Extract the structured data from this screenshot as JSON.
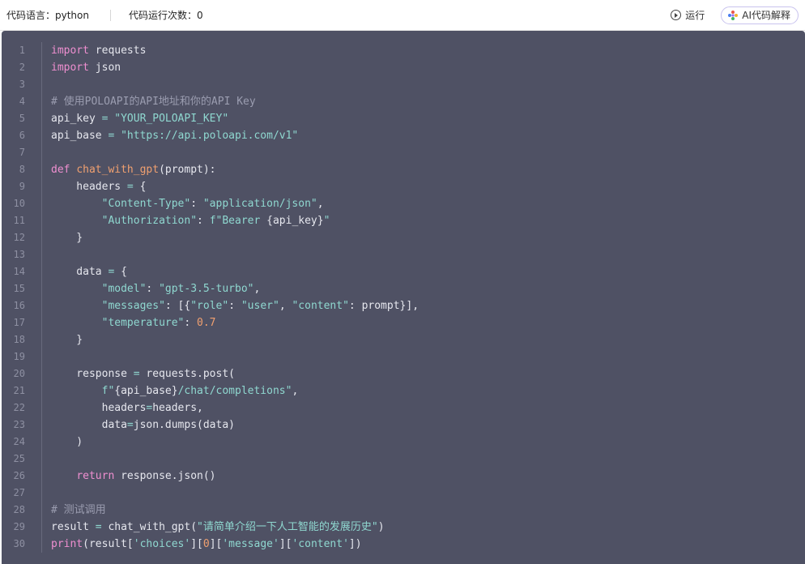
{
  "toolbar": {
    "language_label": "代码语言：python",
    "run_count_label": "代码运行次数：0",
    "run_label": "运行",
    "ai_label": "AI代码解释"
  },
  "code_lines": [
    {
      "n": "1",
      "t": [
        {
          "c": "k",
          "v": "import"
        },
        {
          "c": "p",
          "v": " requests"
        }
      ]
    },
    {
      "n": "2",
      "t": [
        {
          "c": "k",
          "v": "import"
        },
        {
          "c": "p",
          "v": " json"
        }
      ]
    },
    {
      "n": "3",
      "t": []
    },
    {
      "n": "4",
      "t": [
        {
          "c": "c",
          "v": "# 使用POLOAPI的API地址和你的API Key"
        }
      ]
    },
    {
      "n": "5",
      "t": [
        {
          "c": "p",
          "v": "api_key "
        },
        {
          "c": "o",
          "v": "="
        },
        {
          "c": "p",
          "v": " "
        },
        {
          "c": "s",
          "v": "\"YOUR_POLOAPI_KEY\""
        }
      ]
    },
    {
      "n": "6",
      "t": [
        {
          "c": "p",
          "v": "api_base "
        },
        {
          "c": "o",
          "v": "="
        },
        {
          "c": "p",
          "v": " "
        },
        {
          "c": "s",
          "v": "\"https://api.poloapi.com/v1\""
        }
      ]
    },
    {
      "n": "7",
      "t": []
    },
    {
      "n": "8",
      "t": [
        {
          "c": "k",
          "v": "def"
        },
        {
          "c": "p",
          "v": " "
        },
        {
          "c": "f",
          "v": "chat_with_gpt"
        },
        {
          "c": "p",
          "v": "(prompt):"
        }
      ]
    },
    {
      "n": "9",
      "t": [
        {
          "c": "p",
          "v": "    headers "
        },
        {
          "c": "o",
          "v": "="
        },
        {
          "c": "p",
          "v": " {"
        }
      ]
    },
    {
      "n": "10",
      "t": [
        {
          "c": "p",
          "v": "        "
        },
        {
          "c": "s",
          "v": "\"Content-Type\""
        },
        {
          "c": "p",
          "v": ": "
        },
        {
          "c": "s",
          "v": "\"application/json\""
        },
        {
          "c": "p",
          "v": ","
        }
      ]
    },
    {
      "n": "11",
      "t": [
        {
          "c": "p",
          "v": "        "
        },
        {
          "c": "s",
          "v": "\"Authorization\""
        },
        {
          "c": "p",
          "v": ": "
        },
        {
          "c": "s",
          "v": "f\"Bearer "
        },
        {
          "c": "p",
          "v": "{api_key}"
        },
        {
          "c": "s",
          "v": "\""
        }
      ]
    },
    {
      "n": "12",
      "t": [
        {
          "c": "p",
          "v": "    }"
        }
      ]
    },
    {
      "n": "13",
      "t": []
    },
    {
      "n": "14",
      "t": [
        {
          "c": "p",
          "v": "    data "
        },
        {
          "c": "o",
          "v": "="
        },
        {
          "c": "p",
          "v": " {"
        }
      ]
    },
    {
      "n": "15",
      "t": [
        {
          "c": "p",
          "v": "        "
        },
        {
          "c": "s",
          "v": "\"model\""
        },
        {
          "c": "p",
          "v": ": "
        },
        {
          "c": "s",
          "v": "\"gpt-3.5-turbo\""
        },
        {
          "c": "p",
          "v": ","
        }
      ]
    },
    {
      "n": "16",
      "t": [
        {
          "c": "p",
          "v": "        "
        },
        {
          "c": "s",
          "v": "\"messages\""
        },
        {
          "c": "p",
          "v": ": [{"
        },
        {
          "c": "s",
          "v": "\"role\""
        },
        {
          "c": "p",
          "v": ": "
        },
        {
          "c": "s",
          "v": "\"user\""
        },
        {
          "c": "p",
          "v": ", "
        },
        {
          "c": "s",
          "v": "\"content\""
        },
        {
          "c": "p",
          "v": ": prompt}],"
        }
      ]
    },
    {
      "n": "17",
      "t": [
        {
          "c": "p",
          "v": "        "
        },
        {
          "c": "s",
          "v": "\"temperature\""
        },
        {
          "c": "p",
          "v": ": "
        },
        {
          "c": "n",
          "v": "0.7"
        }
      ]
    },
    {
      "n": "18",
      "t": [
        {
          "c": "p",
          "v": "    }"
        }
      ]
    },
    {
      "n": "19",
      "t": []
    },
    {
      "n": "20",
      "t": [
        {
          "c": "p",
          "v": "    response "
        },
        {
          "c": "o",
          "v": "="
        },
        {
          "c": "p",
          "v": " requests.post("
        }
      ]
    },
    {
      "n": "21",
      "t": [
        {
          "c": "p",
          "v": "        "
        },
        {
          "c": "s",
          "v": "f\""
        },
        {
          "c": "p",
          "v": "{api_base}"
        },
        {
          "c": "s",
          "v": "/chat/completions\""
        },
        {
          "c": "p",
          "v": ","
        }
      ]
    },
    {
      "n": "22",
      "t": [
        {
          "c": "p",
          "v": "        headers"
        },
        {
          "c": "o",
          "v": "="
        },
        {
          "c": "p",
          "v": "headers,"
        }
      ]
    },
    {
      "n": "23",
      "t": [
        {
          "c": "p",
          "v": "        data"
        },
        {
          "c": "o",
          "v": "="
        },
        {
          "c": "p",
          "v": "json.dumps(data)"
        }
      ]
    },
    {
      "n": "24",
      "t": [
        {
          "c": "p",
          "v": "    )"
        }
      ]
    },
    {
      "n": "25",
      "t": []
    },
    {
      "n": "26",
      "t": [
        {
          "c": "p",
          "v": "    "
        },
        {
          "c": "k",
          "v": "return"
        },
        {
          "c": "p",
          "v": " response.json()"
        }
      ]
    },
    {
      "n": "27",
      "t": []
    },
    {
      "n": "28",
      "t": [
        {
          "c": "c",
          "v": "# 测试调用"
        }
      ]
    },
    {
      "n": "29",
      "t": [
        {
          "c": "p",
          "v": "result "
        },
        {
          "c": "o",
          "v": "="
        },
        {
          "c": "p",
          "v": " chat_with_gpt("
        },
        {
          "c": "s",
          "v": "\"请简单介绍一下人工智能的发展历史\""
        },
        {
          "c": "p",
          "v": ")"
        }
      ]
    },
    {
      "n": "30",
      "t": [
        {
          "c": "k",
          "v": "print"
        },
        {
          "c": "p",
          "v": "(result["
        },
        {
          "c": "s",
          "v": "'choices'"
        },
        {
          "c": "p",
          "v": "]["
        },
        {
          "c": "n",
          "v": "0"
        },
        {
          "c": "p",
          "v": "]["
        },
        {
          "c": "s",
          "v": "'message'"
        },
        {
          "c": "p",
          "v": "]["
        },
        {
          "c": "s",
          "v": "'content'"
        },
        {
          "c": "p",
          "v": "])"
        }
      ]
    }
  ]
}
